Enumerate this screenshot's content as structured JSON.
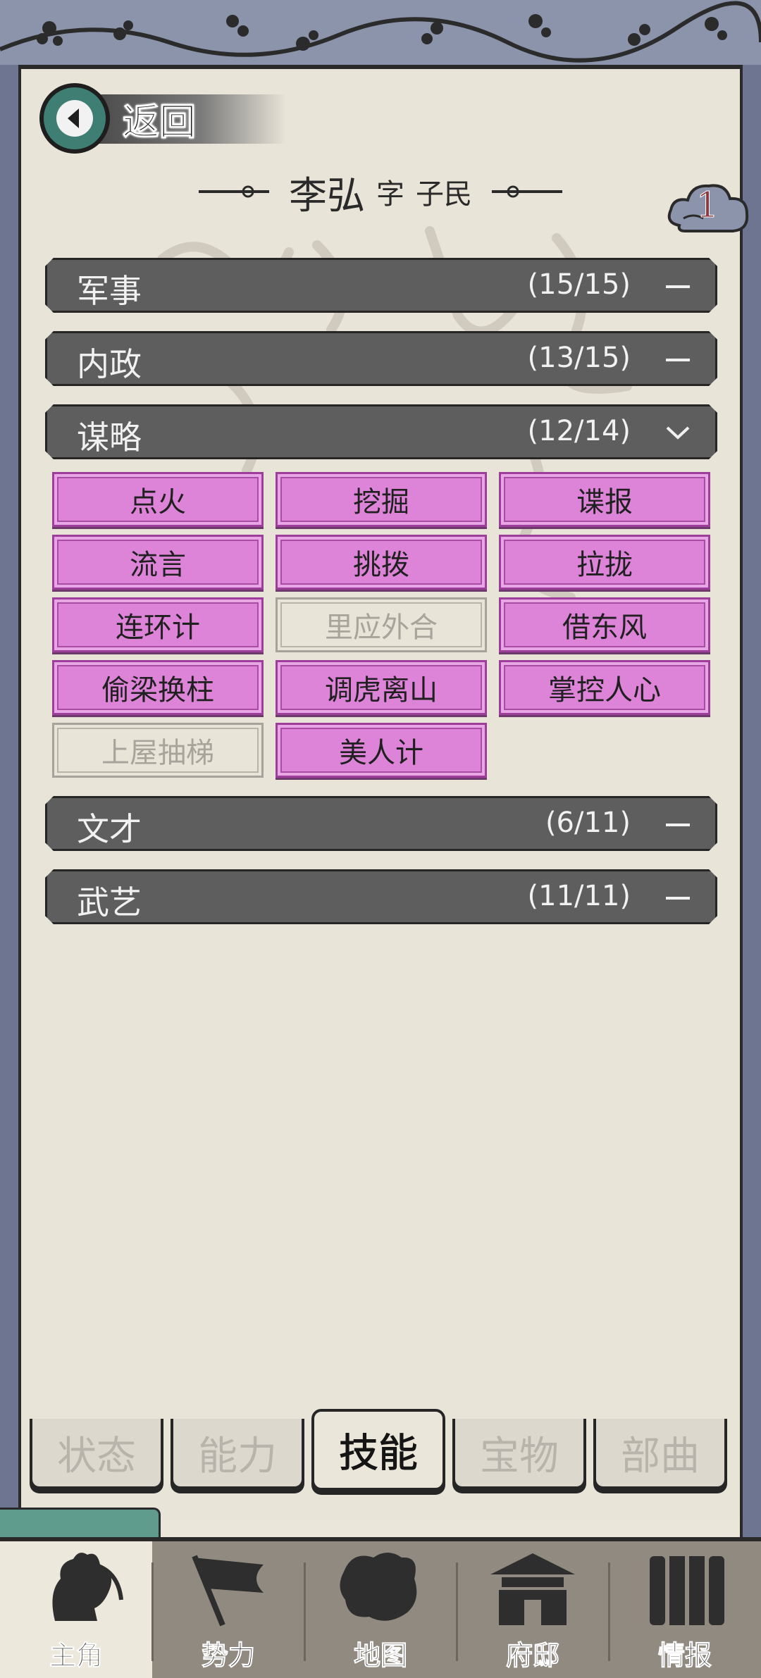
{
  "header": {
    "back_label": "返回",
    "hero_name": "李弘",
    "zi_label": "字",
    "courtesy_name": "子民",
    "badge_count": "1"
  },
  "categories": [
    {
      "name": "军事",
      "count": "(15/15)",
      "state": "collapsed"
    },
    {
      "name": "内政",
      "count": "(13/15)",
      "state": "collapsed"
    },
    {
      "name": "谋略",
      "count": "(12/14)",
      "state": "expanded"
    },
    {
      "name": "文才",
      "count": "(6/11)",
      "state": "collapsed"
    },
    {
      "name": "武艺",
      "count": "(11/11)",
      "state": "collapsed"
    }
  ],
  "skills": [
    {
      "label": "点火",
      "learned": true
    },
    {
      "label": "挖掘",
      "learned": true
    },
    {
      "label": "谍报",
      "learned": true
    },
    {
      "label": "流言",
      "learned": true
    },
    {
      "label": "挑拨",
      "learned": true
    },
    {
      "label": "拉拢",
      "learned": true
    },
    {
      "label": "连环计",
      "learned": true
    },
    {
      "label": "里应外合",
      "learned": false
    },
    {
      "label": "借东风",
      "learned": true
    },
    {
      "label": "偷梁换柱",
      "learned": true
    },
    {
      "label": "调虎离山",
      "learned": true
    },
    {
      "label": "掌控人心",
      "learned": true
    },
    {
      "label": "上屋抽梯",
      "learned": false
    },
    {
      "label": "美人计",
      "learned": true
    }
  ],
  "sub_tabs": [
    {
      "label": "状态",
      "active": false
    },
    {
      "label": "能力",
      "active": false
    },
    {
      "label": "技能",
      "active": true
    },
    {
      "label": "宝物",
      "active": false
    },
    {
      "label": "部曲",
      "active": false
    }
  ],
  "bottom_nav": [
    {
      "label": "主角",
      "icon": "hero-portrait-icon",
      "active": true
    },
    {
      "label": "势力",
      "icon": "faction-flag-icon",
      "active": false
    },
    {
      "label": "地图",
      "icon": "map-icon",
      "active": false
    },
    {
      "label": "府邸",
      "icon": "mansion-icon",
      "active": false
    },
    {
      "label": "情报",
      "icon": "scroll-intel-icon",
      "active": false
    }
  ],
  "colors": {
    "paper": "#e9e4d8",
    "category_bar": "#5e5e5e",
    "skill_learned": "#dd84d9",
    "skill_unlearned_text": "#a9a49b",
    "back_circle": "#3f7f73",
    "border_blue": "#8c94ab"
  }
}
